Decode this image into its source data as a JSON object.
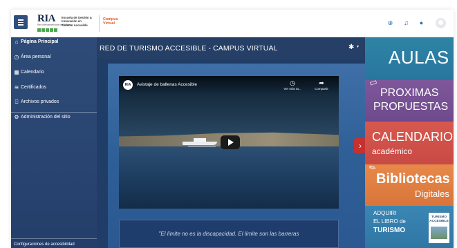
{
  "header": {
    "logo_mark": "RIA",
    "logo_small": "Red Iberoamericana de Turismo",
    "logo_text_lines": [
      "Escuela de Gestión &",
      "Innovación en",
      "Turismo Accesible"
    ],
    "campus_lines": [
      "Campus",
      "Virtual"
    ],
    "icons": {
      "language": "globe-icon",
      "notifications": "bell-icon",
      "messages": "chat-icon",
      "user": "user-avatar"
    },
    "colors": {
      "accent": "#2f6fb7",
      "campus": "#e05a2b"
    }
  },
  "sidebar": {
    "items": [
      {
        "label": "Página Principal",
        "icon": "home-icon",
        "glyph": "⌂"
      },
      {
        "label": "Área personal",
        "icon": "dashboard-icon",
        "glyph": "◷"
      },
      {
        "label": "Calendario",
        "icon": "calendar-icon",
        "glyph": "▦"
      },
      {
        "label": "Certificados",
        "icon": "graduation-cap-icon",
        "glyph": "≋"
      },
      {
        "label": "Archivos privados",
        "icon": "folder-icon",
        "glyph": "⌹"
      },
      {
        "label": "Administración del sitio",
        "icon": "admin-gear-icon",
        "glyph": "⚙"
      }
    ],
    "footer_label": "Configuraciones de accesibilidad",
    "color": "#2e4b78"
  },
  "main": {
    "title": "RED DE TURISMO ACCESIBLE - CAMPUS VIRTUAL",
    "settings_icon": "gear-icon",
    "video": {
      "channel_logo": "RIA",
      "title": "Avistaje de ballenas Accesible",
      "watch_later": "Ver más ta...",
      "share": "Compartir"
    },
    "caption": "\"El límite no es la discapacidad. El límite son las barreras",
    "carousel_next": "›"
  },
  "banners": {
    "aulas": "AULAS",
    "proximas": [
      "PROXIMAS",
      "PROPUESTAS"
    ],
    "calendario": [
      "CALENDARIO",
      "académico"
    ],
    "bibliotecas": [
      "Bibliotecas",
      "Digitales"
    ],
    "libro": [
      "ADQUIRI",
      "EL LIBRO de",
      "TURISMO"
    ],
    "book_cover": [
      "TURISMO",
      "ACCESIBLE"
    ],
    "colors": {
      "aulas": "#2e84a4",
      "proximas": "#7e579a",
      "calendario": "#d7584d",
      "bibliotecas": "#e7894a",
      "libro": "#3b86b3"
    }
  }
}
